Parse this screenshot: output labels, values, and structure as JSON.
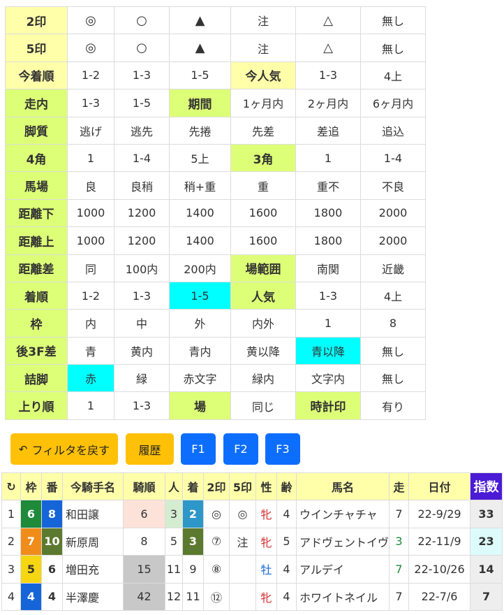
{
  "filters": [
    {
      "cells": [
        {
          "t": "2印",
          "k": "h"
        },
        {
          "t": "◎",
          "k": "c",
          "big": true
        },
        {
          "t": "○",
          "k": "c",
          "big": true
        },
        {
          "t": "▲",
          "k": "c",
          "big": true
        },
        {
          "t": "注",
          "k": "c"
        },
        {
          "t": "△",
          "k": "c",
          "big": true
        },
        {
          "t": "無し",
          "k": "c"
        }
      ]
    },
    {
      "cells": [
        {
          "t": "5印",
          "k": "h"
        },
        {
          "t": "◎",
          "k": "c",
          "big": true
        },
        {
          "t": "○",
          "k": "c",
          "big": true
        },
        {
          "t": "▲",
          "k": "c",
          "big": true
        },
        {
          "t": "注",
          "k": "c"
        },
        {
          "t": "△",
          "k": "c",
          "big": true
        },
        {
          "t": "無し",
          "k": "c"
        }
      ]
    },
    {
      "cells": [
        {
          "t": "今着順",
          "k": "h"
        },
        {
          "t": "1-2",
          "k": "c"
        },
        {
          "t": "1-3",
          "k": "c"
        },
        {
          "t": "1-5",
          "k": "c"
        },
        {
          "t": "今人気",
          "k": "h"
        },
        {
          "t": "1-3",
          "k": "c"
        },
        {
          "t": "4上",
          "k": "c"
        }
      ]
    },
    {
      "cells": [
        {
          "t": "走内",
          "k": "g"
        },
        {
          "t": "1-3",
          "k": "c"
        },
        {
          "t": "1-5",
          "k": "c"
        },
        {
          "t": "期間",
          "k": "g"
        },
        {
          "t": "1ヶ月内",
          "k": "c"
        },
        {
          "t": "2ヶ月内",
          "k": "c"
        },
        {
          "t": "6ヶ月内",
          "k": "c"
        }
      ]
    },
    {
      "cells": [
        {
          "t": "脚質",
          "k": "g"
        },
        {
          "t": "逃げ",
          "k": "c"
        },
        {
          "t": "逃先",
          "k": "c"
        },
        {
          "t": "先捲",
          "k": "c"
        },
        {
          "t": "先差",
          "k": "c"
        },
        {
          "t": "差追",
          "k": "c"
        },
        {
          "t": "追込",
          "k": "c"
        }
      ]
    },
    {
      "cells": [
        {
          "t": "4角",
          "k": "g"
        },
        {
          "t": "1",
          "k": "c"
        },
        {
          "t": "1-4",
          "k": "c"
        },
        {
          "t": "5上",
          "k": "c"
        },
        {
          "t": "3角",
          "k": "g"
        },
        {
          "t": "1",
          "k": "c"
        },
        {
          "t": "1-4",
          "k": "c"
        }
      ]
    },
    {
      "cells": [
        {
          "t": "馬場",
          "k": "g"
        },
        {
          "t": "良",
          "k": "c"
        },
        {
          "t": "良稍",
          "k": "c"
        },
        {
          "t": "稍+重",
          "k": "c"
        },
        {
          "t": "重",
          "k": "c"
        },
        {
          "t": "重不",
          "k": "c"
        },
        {
          "t": "不良",
          "k": "c"
        }
      ]
    },
    {
      "cells": [
        {
          "t": "距離下",
          "k": "g"
        },
        {
          "t": "1000",
          "k": "c"
        },
        {
          "t": "1200",
          "k": "c"
        },
        {
          "t": "1400",
          "k": "c"
        },
        {
          "t": "1600",
          "k": "c"
        },
        {
          "t": "1800",
          "k": "c"
        },
        {
          "t": "2000",
          "k": "c"
        }
      ]
    },
    {
      "cells": [
        {
          "t": "距離上",
          "k": "g"
        },
        {
          "t": "1000",
          "k": "c"
        },
        {
          "t": "1200",
          "k": "c"
        },
        {
          "t": "1400",
          "k": "c"
        },
        {
          "t": "1600",
          "k": "c"
        },
        {
          "t": "1800",
          "k": "c"
        },
        {
          "t": "2000",
          "k": "c"
        }
      ]
    },
    {
      "cells": [
        {
          "t": "距離差",
          "k": "g"
        },
        {
          "t": "同",
          "k": "c"
        },
        {
          "t": "100内",
          "k": "c"
        },
        {
          "t": "200内",
          "k": "c"
        },
        {
          "t": "場範囲",
          "k": "g"
        },
        {
          "t": "南関",
          "k": "c"
        },
        {
          "t": "近畿",
          "k": "c"
        }
      ]
    },
    {
      "cells": [
        {
          "t": "着順",
          "k": "g"
        },
        {
          "t": "1-2",
          "k": "c"
        },
        {
          "t": "1-3",
          "k": "c"
        },
        {
          "t": "1-5",
          "k": "c",
          "on": true
        },
        {
          "t": "人気",
          "k": "g"
        },
        {
          "t": "1-3",
          "k": "c"
        },
        {
          "t": "4上",
          "k": "c"
        }
      ]
    },
    {
      "cells": [
        {
          "t": "枠",
          "k": "g"
        },
        {
          "t": "内",
          "k": "c"
        },
        {
          "t": "中",
          "k": "c"
        },
        {
          "t": "外",
          "k": "c"
        },
        {
          "t": "内外",
          "k": "c"
        },
        {
          "t": "1",
          "k": "c"
        },
        {
          "t": "8",
          "k": "c"
        }
      ]
    },
    {
      "cells": [
        {
          "t": "後3F差",
          "k": "g"
        },
        {
          "t": "青",
          "k": "c"
        },
        {
          "t": "黄内",
          "k": "c"
        },
        {
          "t": "青内",
          "k": "c"
        },
        {
          "t": "黄以降",
          "k": "c"
        },
        {
          "t": "青以降",
          "k": "c",
          "on": true
        },
        {
          "t": "無し",
          "k": "c"
        }
      ]
    },
    {
      "cells": [
        {
          "t": "詰脚",
          "k": "g"
        },
        {
          "t": "赤",
          "k": "c",
          "on": true
        },
        {
          "t": "緑",
          "k": "c"
        },
        {
          "t": "赤文字",
          "k": "c"
        },
        {
          "t": "緑内",
          "k": "c"
        },
        {
          "t": "文字内",
          "k": "c"
        },
        {
          "t": "無し",
          "k": "c"
        }
      ]
    },
    {
      "cells": [
        {
          "t": "上り順",
          "k": "g"
        },
        {
          "t": "1",
          "k": "c"
        },
        {
          "t": "1-3",
          "k": "c"
        },
        {
          "t": "場",
          "k": "g"
        },
        {
          "t": "同じ",
          "k": "c"
        },
        {
          "t": "時計印",
          "k": "g"
        },
        {
          "t": "有り",
          "k": "c"
        }
      ]
    }
  ],
  "buttons": {
    "reset": "フィルタを戻す",
    "history": "履歴",
    "f1": "F1",
    "f2": "F2",
    "f3": "F3"
  },
  "results": {
    "headers": [
      "↻",
      "枠",
      "番",
      "今騎手名",
      "騎順",
      "人",
      "着",
      "2印",
      "5印",
      "性",
      "齢",
      "馬名",
      "走",
      "日付",
      "指数"
    ],
    "rows": [
      {
        "no": "1",
        "waku": "6",
        "wakuClass": "w6",
        "ban": "8",
        "banClass": "w4",
        "jockey": "和田譲",
        "kijun": "6",
        "kijunClass": "rk-pink",
        "ninki": "3",
        "ninkiClass": "ni-green",
        "chaku": "2",
        "chakuClass": "ch-blue",
        "m2": "◎",
        "m5": "◎",
        "sex": "牝",
        "sexClass": "sx-f",
        "age": "4",
        "horse": "ウインチャチャ",
        "run": "7",
        "runClass": "",
        "date": "22-9/29",
        "index": "33",
        "idxClass": ""
      },
      {
        "no": "2",
        "waku": "7",
        "wakuClass": "w7",
        "ban": "10",
        "banClass": "ch-olive",
        "jockey": "新原周",
        "kijun": "8",
        "kijunClass": "",
        "ninki": "5",
        "ninkiClass": "",
        "chaku": "3",
        "chakuClass": "ch-olive",
        "m2": "⑦",
        "m5": "注",
        "sex": "牝",
        "sexClass": "sx-f",
        "age": "5",
        "horse": "アドヴェントイヴ",
        "run": "3",
        "runClass": "run-green",
        "date": "22-11/9",
        "index": "23",
        "idxClass": "idx-hi"
      },
      {
        "no": "3",
        "waku": "5",
        "wakuClass": "w5",
        "ban": "6",
        "banClass": "",
        "jockey": "増田充",
        "kijun": "15",
        "kijunClass": "rk-grey",
        "ninki": "11",
        "ninkiClass": "",
        "chaku": "9",
        "chakuClass": "",
        "m2": "⑧",
        "m5": "",
        "sex": "牡",
        "sexClass": "sx-m",
        "age": "4",
        "horse": "アルデイ",
        "run": "7",
        "runClass": "run-green",
        "date": "22-10/26",
        "index": "14",
        "idxClass": ""
      },
      {
        "no": "4",
        "waku": "4",
        "wakuClass": "w4",
        "ban": "4",
        "banClass": "",
        "jockey": "半澤慶",
        "kijun": "42",
        "kijunClass": "rk-grey",
        "ninki": "12",
        "ninkiClass": "",
        "chaku": "11",
        "chakuClass": "",
        "m2": "⑫",
        "m5": "",
        "sex": "牝",
        "sexClass": "sx-f",
        "age": "4",
        "horse": "ホワイトネイル",
        "run": "7",
        "runClass": "",
        "date": "22-7/6",
        "index": "7",
        "idxClass": ""
      }
    ]
  },
  "colors": {
    "header_yellow": "#ffffaa",
    "header_green": "#ddff77",
    "selected_cyan": "#00ffff",
    "btn_warning": "#ffc107",
    "btn_primary": "#0d6efd",
    "index_header": "#4b1bd6"
  },
  "icons": {
    "reset": "undo-arrow-icon",
    "reload": "reload-icon"
  }
}
